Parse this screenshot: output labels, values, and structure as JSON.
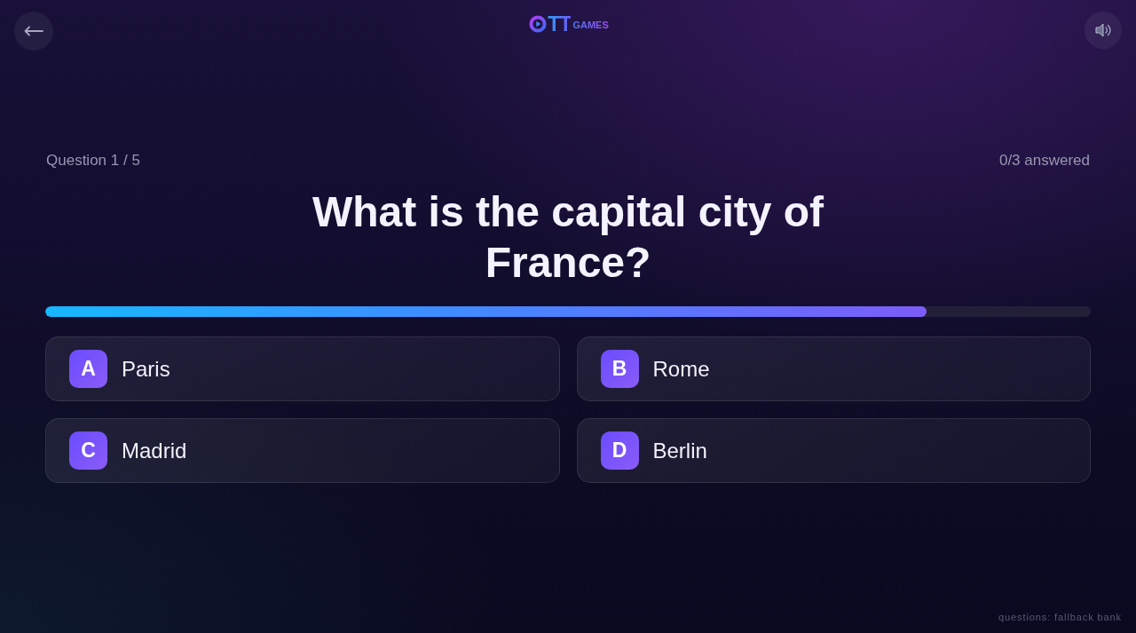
{
  "header": {
    "logo": {
      "letters": "TT",
      "word": "GAMES"
    }
  },
  "quiz": {
    "progress_label": "Question 1 / 5",
    "answered": "0/3 answered",
    "question": "What is the capital city of France?",
    "timer": {
      "level": 0.843
    },
    "options": [
      {
        "letter": "A",
        "text": "Paris",
        "selected": false
      },
      {
        "letter": "B",
        "text": "Rome",
        "selected": false
      },
      {
        "letter": "C",
        "text": "Madrid",
        "selected": false
      },
      {
        "letter": "D",
        "text": "Berlin",
        "selected": false
      }
    ]
  },
  "footer": {
    "source": "questions: fallback bank"
  }
}
